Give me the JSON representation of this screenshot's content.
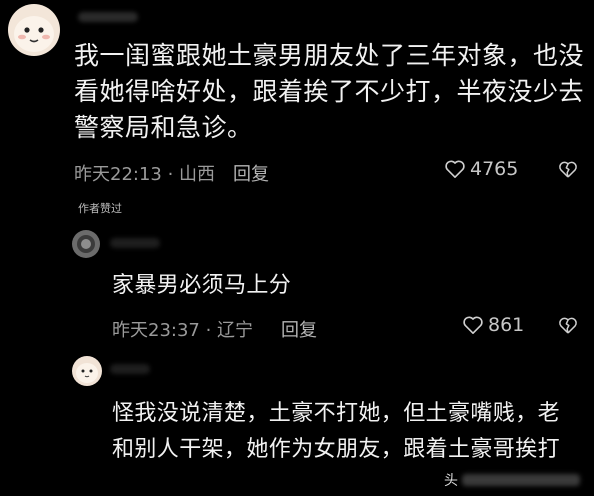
{
  "comments": [
    {
      "text": "我一闺蜜跟她土豪男朋友处了三年对象，也没看她得啥好处，跟着挨了不少打，半夜没少去警察局和急诊。",
      "meta": "昨天22:13 · 山西",
      "reply_label": "回复",
      "likes": "4765",
      "badge": "作者赞过"
    }
  ],
  "replies": [
    {
      "text": "家暴男必须马上分",
      "meta": "昨天23:37 · 辽宁",
      "reply_label": "回复",
      "likes": "861"
    },
    {
      "text": "怪我没说清楚，土豪不打她，但土豪嘴贱，老和别人干架，她作为女朋友，跟着土豪哥挨打"
    }
  ],
  "watermark": {
    "text": "头"
  },
  "colors": {
    "background": "#000000",
    "text": "#f2f2f2",
    "meta": "#9a9a9a"
  }
}
